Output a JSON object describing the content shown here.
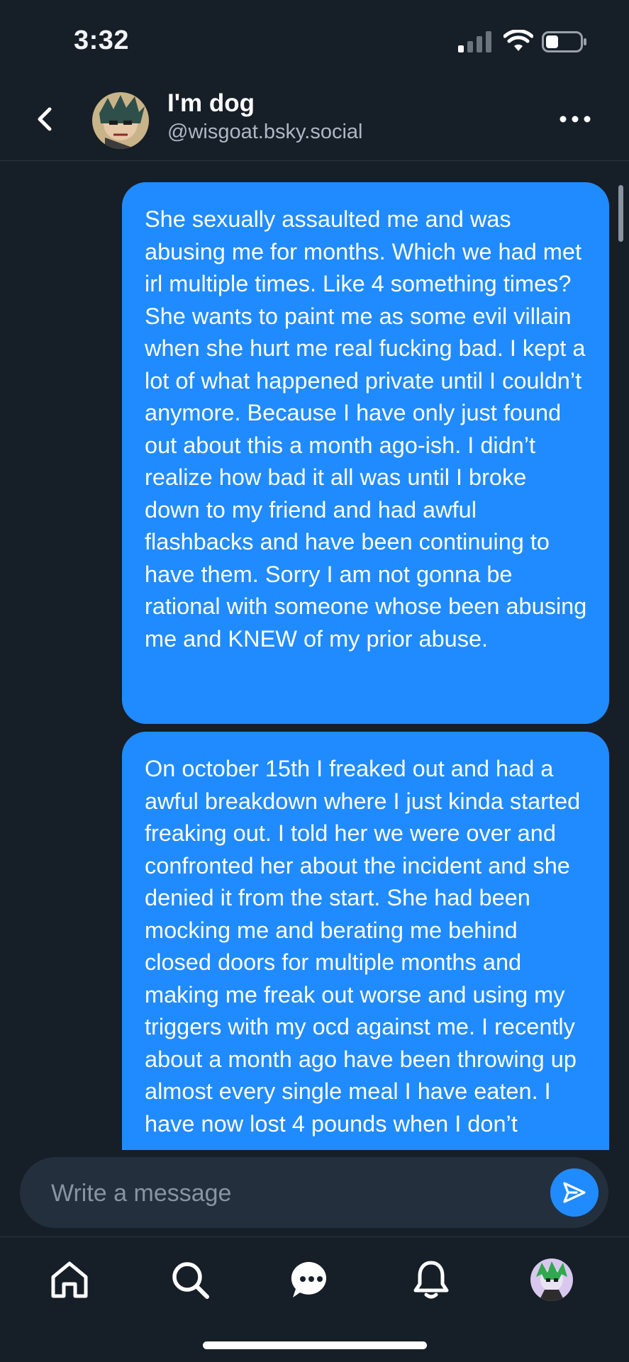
{
  "status_bar": {
    "time": "3:32"
  },
  "header": {
    "name": "I'm dog",
    "handle": "@wisgoat.bsky.social"
  },
  "messages": [
    {
      "text": "She sexually assaulted me and was abusing me for months. Which we had met irl multiple times. Like 4 something times? She wants to paint me as some evil villain when she hurt me real fucking bad. I kept a lot of what happened private until I couldn’t anymore. Because I have only just found out about this a month ago-ish. I didn’t realize how bad it all was until I broke down to my friend and had awful flashbacks and have been continuing to have them. Sorry I am not gonna be rational with someone whose been abusing me and KNEW of my prior abuse."
    },
    {
      "text": "On october 15th I freaked out and had a awful breakdown where I just kinda started freaking out. I told her we were over and confronted her about the incident and she denied it from the start. She had been mocking me and berating me behind closed doors for multiple months and making me freak out worse and using my triggers with my ocd against me. I recently about a month ago have been throwing up almost every single meal I have eaten. I have now lost 4 pounds when I don’t"
    }
  ],
  "composer": {
    "placeholder": "Write a message"
  },
  "icons": {
    "back": "chevron-left-icon",
    "more": "ellipsis-icon",
    "send": "send-icon",
    "home": "home-icon",
    "search": "search-icon",
    "chat": "chat-icon",
    "notifications": "bell-icon",
    "profile": "avatar"
  },
  "colors": {
    "background": "#161e27",
    "bubble": "#208bfe",
    "accent": "#208bfe",
    "composer": "#232f3d"
  }
}
